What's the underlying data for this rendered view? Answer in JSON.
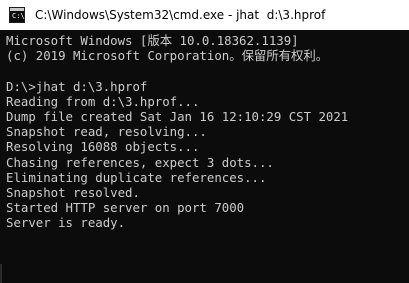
{
  "window": {
    "title": "C:\\Windows\\System32\\cmd.exe - jhat  d:\\3.hprof",
    "icon": "cmd-icon",
    "icon_prompt": "C:\\"
  },
  "console": {
    "lines": [
      "Microsoft Windows [版本 10.0.18362.1139]",
      "(c) 2019 Microsoft Corporation。保留所有权利。",
      "",
      "D:\\>jhat d:\\3.hprof",
      "Reading from d:\\3.hprof...",
      "Dump file created Sat Jan 16 12:10:29 CST 2021",
      "Snapshot read, resolving...",
      "Resolving 16088 objects...",
      "Chasing references, expect 3 dots...",
      "Eliminating duplicate references...",
      "Snapshot resolved.",
      "Started HTTP server on port 7000",
      "Server is ready."
    ],
    "text_color": "#cccccc",
    "background": "#0c0c0c"
  }
}
